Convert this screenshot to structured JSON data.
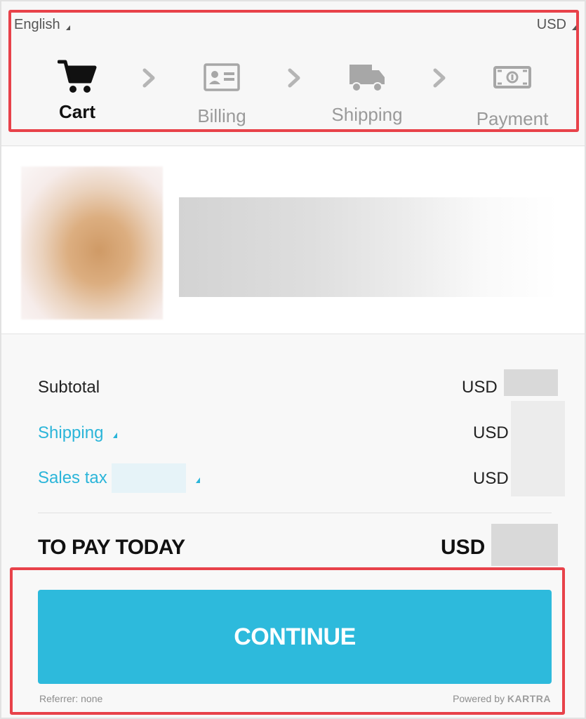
{
  "header": {
    "language": "English",
    "currency": "USD"
  },
  "steps": [
    {
      "label": "Cart",
      "icon": "cart-icon",
      "active": true
    },
    {
      "label": "Billing",
      "icon": "id-card-icon",
      "active": false
    },
    {
      "label": "Shipping",
      "icon": "truck-icon",
      "active": false
    },
    {
      "label": "Payment",
      "icon": "banknote-icon",
      "active": false
    }
  ],
  "summary": {
    "subtotal_label": "Subtotal",
    "subtotal_currency": "USD",
    "shipping_label": "Shipping",
    "shipping_currency": "USD",
    "tax_label": "Sales tax",
    "tax_currency": "USD",
    "total_label": "TO PAY TODAY",
    "total_currency": "USD"
  },
  "actions": {
    "continue_label": "CONTINUE"
  },
  "footer": {
    "referrer": "Referrer: none",
    "powered_prefix": "Powered by",
    "powered_brand": "KARTRA"
  },
  "colors": {
    "accent": "#2dbadc",
    "link": "#2bb5d9",
    "highlight": "#e8424a",
    "inactive_step": "#9a9a9a"
  }
}
